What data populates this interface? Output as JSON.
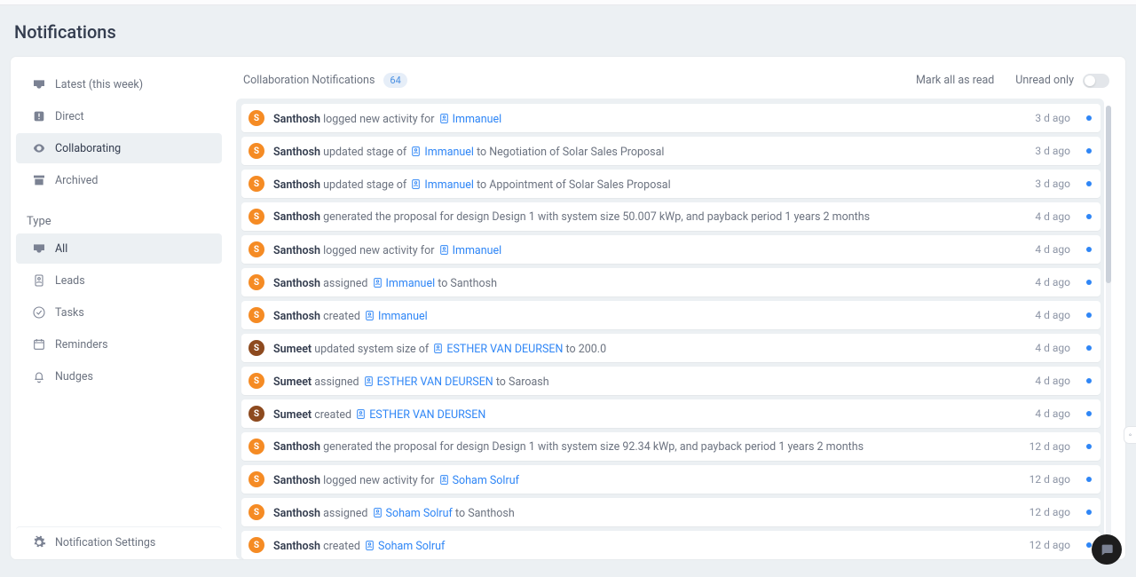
{
  "title": "Notifications",
  "sidebar": {
    "groups": [
      [
        {
          "id": "latest",
          "label": "Latest (this week)",
          "icon": "inbox"
        },
        {
          "id": "direct",
          "label": "Direct",
          "icon": "exclaim"
        },
        {
          "id": "collaborating",
          "label": "Collaborating",
          "icon": "eye",
          "active": true
        },
        {
          "id": "archived",
          "label": "Archived",
          "icon": "archive"
        }
      ],
      [
        {
          "id": "all",
          "label": "All",
          "icon": "inbox",
          "active": true
        },
        {
          "id": "leads",
          "label": "Leads",
          "icon": "lead"
        },
        {
          "id": "tasks",
          "label": "Tasks",
          "icon": "check"
        },
        {
          "id": "reminders",
          "label": "Reminders",
          "icon": "calendar"
        },
        {
          "id": "nudges",
          "label": "Nudges",
          "icon": "bell"
        }
      ]
    ],
    "typeHeading": "Type",
    "settings": {
      "label": "Notification Settings",
      "icon": "gear"
    }
  },
  "header": {
    "title": "Collaboration Notifications",
    "count": "64",
    "markAll": "Mark all as read",
    "unreadOnly": "Unread only"
  },
  "items": [
    {
      "avatar": "S",
      "color": "orange",
      "actor": "Santhosh",
      "pre": " logged new activity for ",
      "linkText": "Immanuel",
      "post": "",
      "time": "3 d ago",
      "unread": true
    },
    {
      "avatar": "S",
      "color": "orange",
      "actor": "Santhosh",
      "pre": " updated stage of ",
      "linkText": "Immanuel",
      "post": " to Negotiation of Solar Sales Proposal",
      "time": "3 d ago",
      "unread": true
    },
    {
      "avatar": "S",
      "color": "orange",
      "actor": "Santhosh",
      "pre": " updated stage of ",
      "linkText": "Immanuel",
      "post": " to Appointment of Solar Sales Proposal",
      "time": "3 d ago",
      "unread": true
    },
    {
      "avatar": "S",
      "color": "orange",
      "actor": "Santhosh",
      "pre": " generated the proposal for design Design 1 with system size 50.007 kWp, and payback period 1 years 2 months",
      "linkText": "",
      "post": "",
      "time": "4 d ago",
      "unread": true
    },
    {
      "avatar": "S",
      "color": "orange",
      "actor": "Santhosh",
      "pre": " logged new activity for ",
      "linkText": "Immanuel",
      "post": "",
      "time": "4 d ago",
      "unread": true
    },
    {
      "avatar": "S",
      "color": "orange",
      "actor": "Santhosh",
      "pre": " assigned ",
      "linkText": "Immanuel",
      "post": " to Santhosh",
      "time": "4 d ago",
      "unread": true
    },
    {
      "avatar": "S",
      "color": "orange",
      "actor": "Santhosh",
      "pre": " created ",
      "linkText": "Immanuel",
      "post": "",
      "time": "4 d ago",
      "unread": true
    },
    {
      "avatar": "S",
      "color": "brown",
      "actor": "Sumeet",
      "pre": " updated system size of ",
      "linkText": "ESTHER VAN DEURSEN",
      "post": " to 200.0",
      "time": "4 d ago",
      "unread": true
    },
    {
      "avatar": "S",
      "color": "orange",
      "actor": "Sumeet",
      "pre": " assigned ",
      "linkText": "ESTHER VAN DEURSEN",
      "post": " to Saroash",
      "time": "4 d ago",
      "unread": true
    },
    {
      "avatar": "S",
      "color": "brown",
      "actor": "Sumeet",
      "pre": " created ",
      "linkText": "ESTHER VAN DEURSEN",
      "post": "",
      "time": "4 d ago",
      "unread": true
    },
    {
      "avatar": "S",
      "color": "orange",
      "actor": "Santhosh",
      "pre": " generated the proposal for design Design 1 with system size 92.34 kWp, and payback period 1 years 2 months",
      "linkText": "",
      "post": "",
      "time": "12 d ago",
      "unread": true
    },
    {
      "avatar": "S",
      "color": "orange",
      "actor": "Santhosh",
      "pre": " logged new activity for ",
      "linkText": "Soham Solruf",
      "post": "",
      "time": "12 d ago",
      "unread": true
    },
    {
      "avatar": "S",
      "color": "orange",
      "actor": "Santhosh",
      "pre": " assigned ",
      "linkText": "Soham Solruf",
      "post": " to Santhosh",
      "time": "12 d ago",
      "unread": true
    },
    {
      "avatar": "S",
      "color": "orange",
      "actor": "Santhosh",
      "pre": " created ",
      "linkText": "Soham Solruf",
      "post": "",
      "time": "12 d ago",
      "unread": true
    }
  ]
}
